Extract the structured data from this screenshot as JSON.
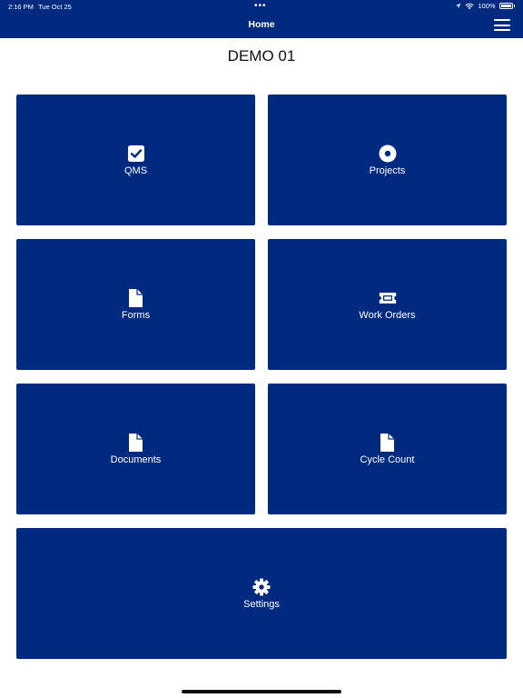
{
  "status_bar": {
    "time": "2:16 PM",
    "date": "Tue Oct 25",
    "dots": "•••",
    "battery": "100%"
  },
  "nav": {
    "title": "Home"
  },
  "page": {
    "title": "DEMO 01"
  },
  "tiles": {
    "qms": {
      "label": "QMS",
      "icon": "checkbox-icon"
    },
    "projects": {
      "label": "Projects",
      "icon": "target-icon"
    },
    "forms": {
      "label": "Forms",
      "icon": "file-icon"
    },
    "work_orders": {
      "label": "Work Orders",
      "icon": "ticket-icon"
    },
    "documents": {
      "label": "Documents",
      "icon": "file-icon"
    },
    "cycle_count": {
      "label": "Cycle Count",
      "icon": "file-icon"
    },
    "settings": {
      "label": "Settings",
      "icon": "gear-icon"
    }
  },
  "colors": {
    "brand": "#002a80",
    "background": "#ffffff",
    "text": "#111111"
  }
}
